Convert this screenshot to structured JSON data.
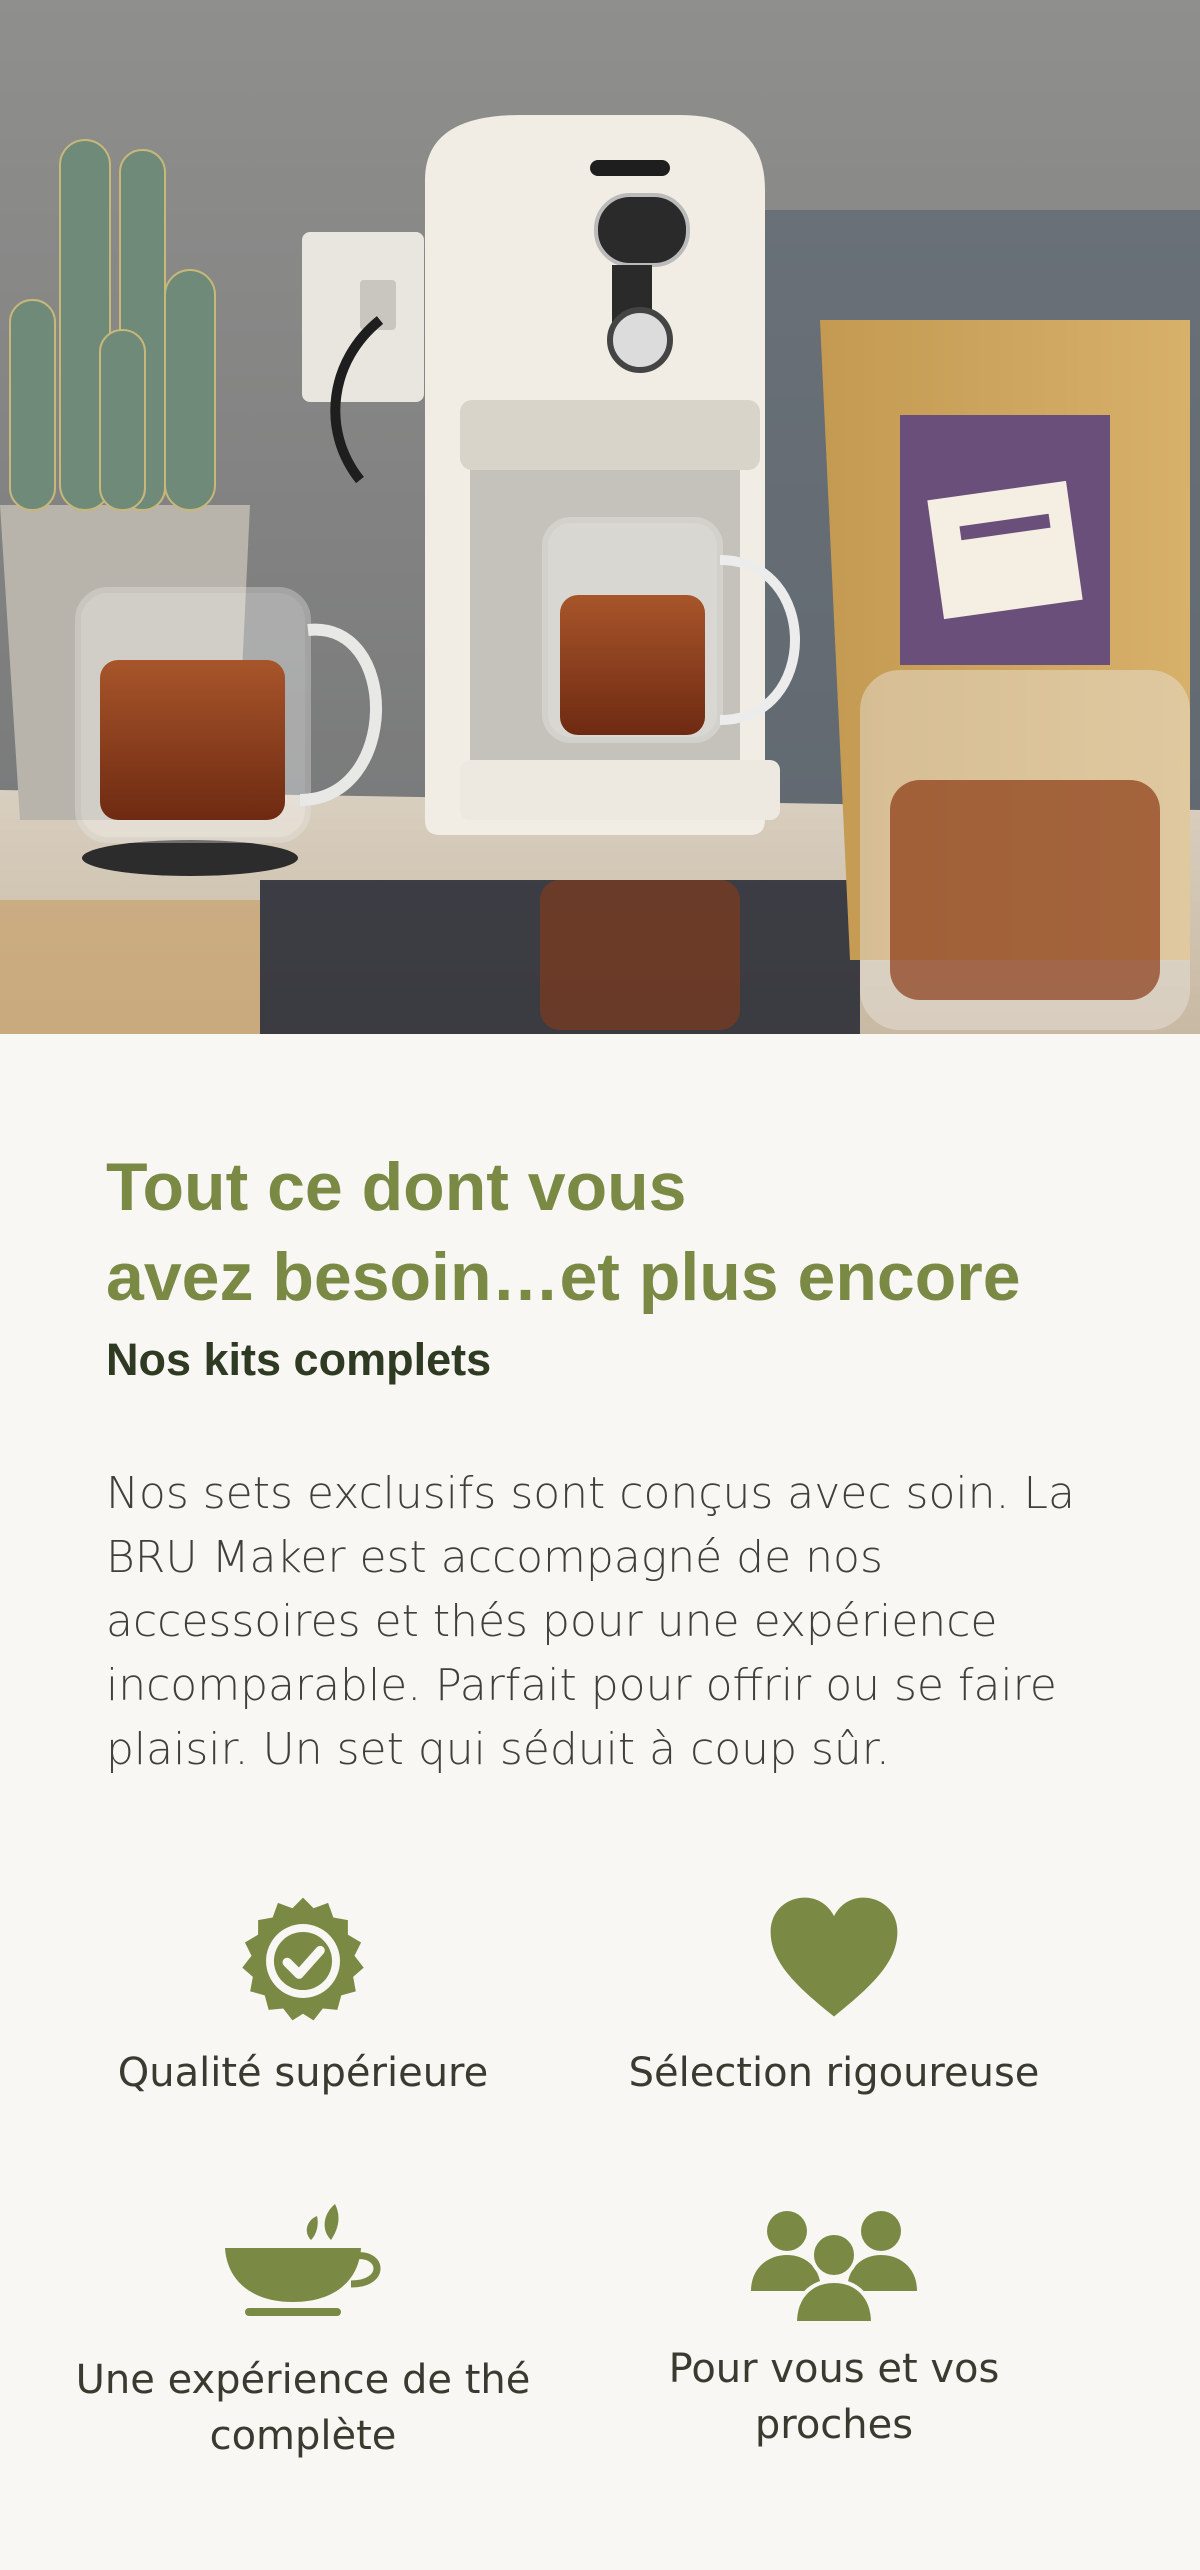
{
  "hero": {
    "image_label": "BRU Maker tea machine with tea glasses, cactus and WACH-TEE tea pouch"
  },
  "headline": {
    "line1": "Tout ce dont vous",
    "line2": "avez besoin…et plus encore"
  },
  "subheadline": "Nos kits complets",
  "paragraph": "Nos sets exclusifs sont conçus avec soin. La BRU Maker est accompagné de nos accessoires et thés pour une expérience incomparable. Parfait pour offrir ou se faire plaisir. Un set qui séduit à coup sûr.",
  "features": [
    {
      "icon": "badge-check-icon",
      "label": "Qualité supérieure"
    },
    {
      "icon": "heart-icon",
      "label": "Sélection rigoureuse"
    },
    {
      "icon": "tea-cup-icon",
      "label": "Une expérience de thé complète"
    },
    {
      "icon": "people-group-icon",
      "label": "Pour vous et vos proches"
    }
  ],
  "colors": {
    "accent": "#7a8a45",
    "dark_green": "#2f3a22",
    "background": "#f8f7f3"
  }
}
